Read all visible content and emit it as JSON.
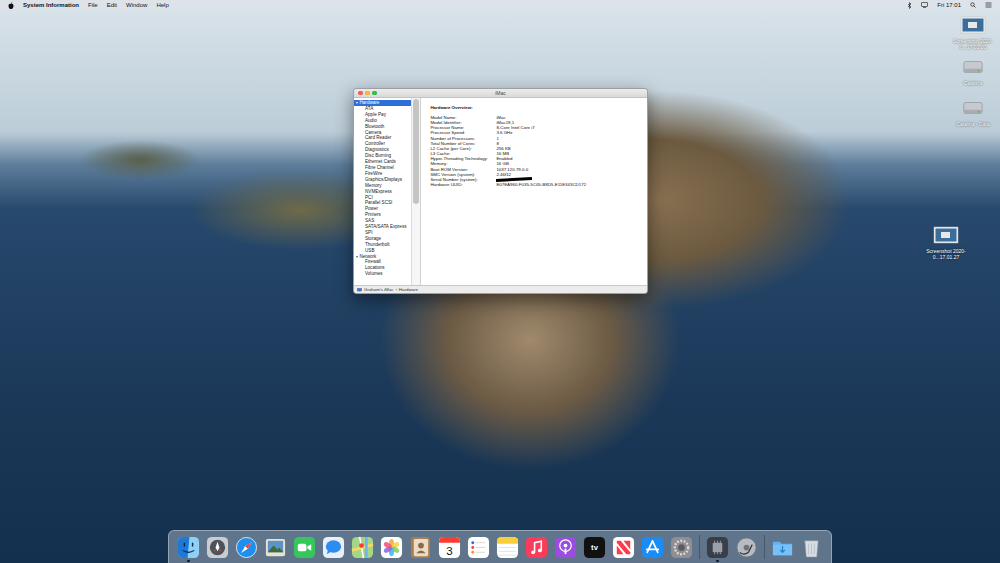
{
  "menu_bar": {
    "app": "System Information",
    "menus": [
      "File",
      "Edit",
      "Window",
      "Help"
    ],
    "clock": "Fri 17:01"
  },
  "desktop_icons": [
    {
      "label": "Screenshot 2020-0...17.01.00",
      "kind": "screenshot"
    },
    {
      "label": "Catalina",
      "kind": "disk"
    },
    {
      "label": "Catalina - Data",
      "kind": "disk"
    },
    {
      "label": "Screenshot 2020-0...17.01.27",
      "kind": "screenshot"
    }
  ],
  "window": {
    "title": "iMac",
    "active": true,
    "buttons": [
      {
        "name": "close",
        "color": "#fe5f57"
      },
      {
        "name": "minimize",
        "color": "#febc2e"
      },
      {
        "name": "zoom",
        "color": "#28c840"
      }
    ]
  },
  "sidebar": {
    "sections": [
      {
        "label": "Hardware",
        "expanded": true,
        "selected": true,
        "items": [
          {
            "label": "ATA",
            "selected": false
          },
          {
            "label": "Apple Pay",
            "selected": false
          },
          {
            "label": "Audio",
            "selected": false
          },
          {
            "label": "Bluetooth",
            "selected": false
          },
          {
            "label": "Camera",
            "selected": false
          },
          {
            "label": "Card Reader",
            "selected": false
          },
          {
            "label": "Controller",
            "selected": false
          },
          {
            "label": "Diagnostics",
            "selected": false
          },
          {
            "label": "Disc Burning",
            "selected": false
          },
          {
            "label": "Ethernet Cards",
            "selected": false
          },
          {
            "label": "Fibre Channel",
            "selected": false
          },
          {
            "label": "FireWire",
            "selected": false
          },
          {
            "label": "Graphics/Displays",
            "selected": false
          },
          {
            "label": "Memory",
            "selected": false
          },
          {
            "label": "NVMExpress",
            "selected": false
          },
          {
            "label": "PCI",
            "selected": false
          },
          {
            "label": "Parallel SCSI",
            "selected": false
          },
          {
            "label": "Power",
            "selected": false
          },
          {
            "label": "Printers",
            "selected": false
          },
          {
            "label": "SAS",
            "selected": false
          },
          {
            "label": "SATA/SATA Express",
            "selected": false
          },
          {
            "label": "SPI",
            "selected": false
          },
          {
            "label": "Storage",
            "selected": false
          },
          {
            "label": "Thunderbolt",
            "selected": false
          },
          {
            "label": "USB",
            "selected": false
          }
        ]
      },
      {
        "label": "Network",
        "expanded": true,
        "selected": false,
        "items": [
          {
            "label": "Firewall",
            "selected": false
          },
          {
            "label": "Locations",
            "selected": false
          },
          {
            "label": "Volumes",
            "selected": false
          }
        ]
      }
    ]
  },
  "overview": {
    "heading": "Hardware Overview:",
    "rows": [
      {
        "label": "Model Name:",
        "value": "iMac",
        "redacted": false
      },
      {
        "label": "Model Identifier:",
        "value": "iMac19,1",
        "redacted": false
      },
      {
        "label": "Processor Name:",
        "value": "8-Core Intel Core i7",
        "redacted": false
      },
      {
        "label": "Processor Speed:",
        "value": "3.6 GHz",
        "redacted": false
      },
      {
        "label": "Number of Processors:",
        "value": "1",
        "redacted": false
      },
      {
        "label": "Total Number of Cores:",
        "value": "8",
        "redacted": false
      },
      {
        "label": "L2 Cache (per Core):",
        "value": "256 KB",
        "redacted": false
      },
      {
        "label": "L3 Cache:",
        "value": "16 MB",
        "redacted": false
      },
      {
        "label": "Hyper-Threading Technology:",
        "value": "Enabled",
        "redacted": false
      },
      {
        "label": "Memory:",
        "value": "16 GB",
        "redacted": false
      },
      {
        "label": "Boot ROM Version:",
        "value": "1037.120.79.0.0",
        "redacted": false
      },
      {
        "label": "SMC Version (system):",
        "value": "2.46f12",
        "redacted": false
      },
      {
        "label": "Serial Number (system):",
        "value": "",
        "redacted": true
      },
      {
        "label": "Hardware UUID:",
        "value": "E07EA960-F035-5C05-B8D5-E11E343CD172",
        "redacted": false
      }
    ]
  },
  "path_bar": {
    "items": [
      "Graham's iMac",
      "Hardware"
    ],
    "separator": "›"
  },
  "dock": {
    "items": [
      {
        "kind": "finder",
        "running": true
      },
      {
        "kind": "launchpad",
        "running": false
      },
      {
        "kind": "safari",
        "running": false
      },
      {
        "kind": "preview",
        "running": false
      },
      {
        "kind": "facetime",
        "running": false
      },
      {
        "kind": "messages",
        "running": false
      },
      {
        "kind": "maps",
        "running": false
      },
      {
        "kind": "photos",
        "running": false
      },
      {
        "kind": "contacts",
        "running": false
      },
      {
        "kind": "calendar",
        "running": false,
        "text": "3"
      },
      {
        "kind": "reminders",
        "running": false
      },
      {
        "kind": "notes",
        "running": false
      },
      {
        "kind": "music",
        "running": false
      },
      {
        "kind": "podcasts",
        "running": false
      },
      {
        "kind": "tv",
        "running": false,
        "text": "tv"
      },
      {
        "kind": "news",
        "running": false
      },
      {
        "kind": "appstore",
        "running": false
      },
      {
        "kind": "sysprefs",
        "running": false
      },
      {
        "kind": "separator"
      },
      {
        "kind": "sysinfo",
        "running": true
      },
      {
        "kind": "diskutility",
        "running": false
      },
      {
        "kind": "separator"
      },
      {
        "kind": "downloads",
        "running": false
      },
      {
        "kind": "trash",
        "running": false
      }
    ]
  }
}
